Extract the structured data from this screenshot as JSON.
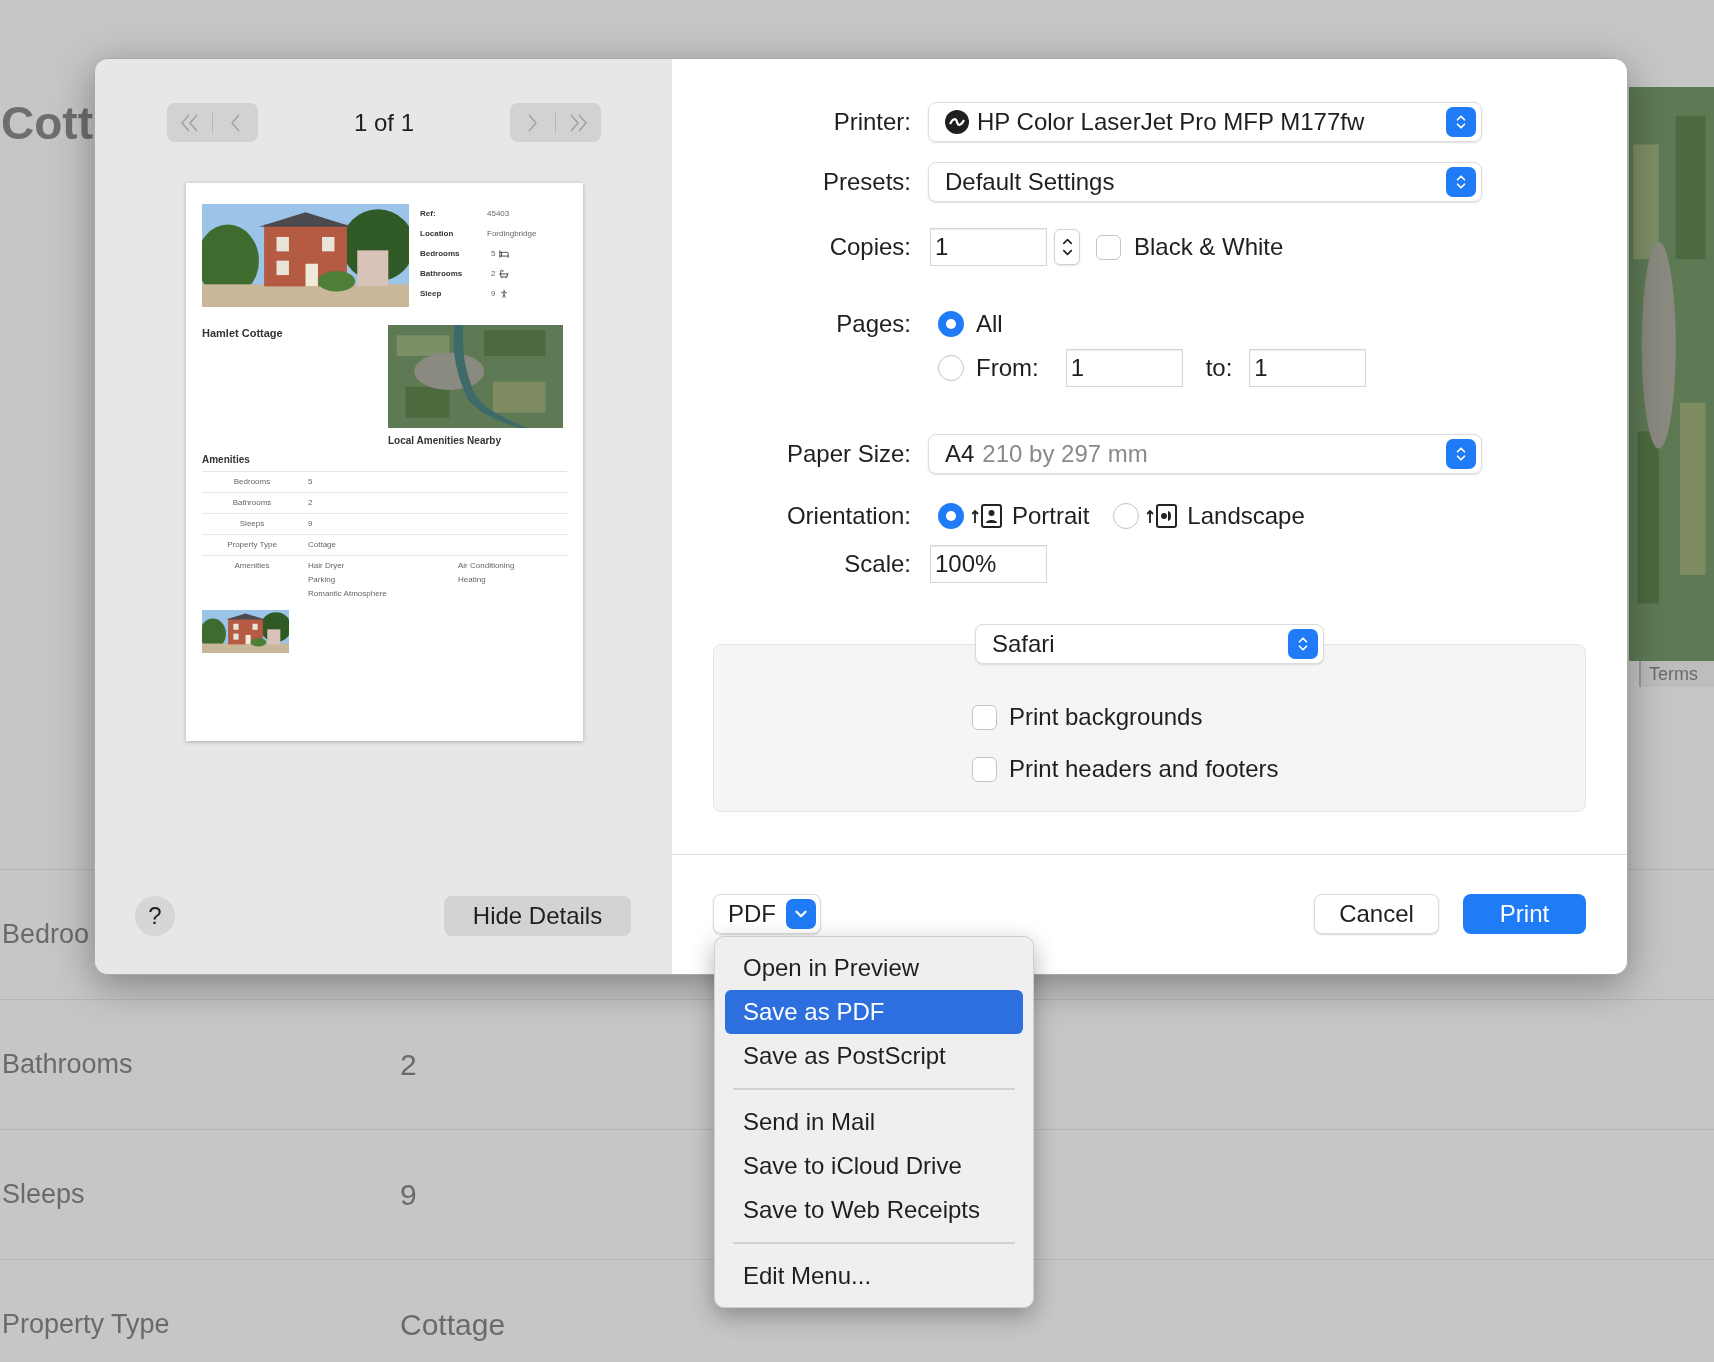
{
  "background": {
    "heading": "Cott",
    "terms": "Terms",
    "rows": [
      {
        "label": "Bedroo",
        "value": ""
      },
      {
        "label": "Bathrooms",
        "value": "2"
      },
      {
        "label": "Sleeps",
        "value": "9"
      },
      {
        "label": "Property Type",
        "value": "Cottage"
      }
    ]
  },
  "preview": {
    "page_indicator": "1 of 1",
    "nav_buttons": [
      {
        "kind": "first",
        "disabled": true
      },
      {
        "kind": "previous",
        "disabled": true
      },
      {
        "kind": "next",
        "disabled": true
      },
      {
        "kind": "last",
        "disabled": true
      }
    ],
    "page": {
      "facts": [
        {
          "label": "Ref:",
          "value": "45403"
        },
        {
          "label": "Location",
          "value": "Fordingbridge"
        },
        {
          "label": "Bedrooms",
          "value": "5"
        },
        {
          "label": "Bathrooms",
          "value": "2"
        },
        {
          "label": "Sleep",
          "value": "9"
        }
      ],
      "title": "Hamlet Cottage",
      "map_caption": "Local Amenities Nearby",
      "amenities_heading": "Amenities",
      "table": [
        {
          "label": "Bedrooms",
          "values": [
            "5"
          ]
        },
        {
          "label": "Bathrooms",
          "values": [
            "2"
          ]
        },
        {
          "label": "Sleeps",
          "values": [
            "9"
          ]
        },
        {
          "label": "Property Type",
          "values": [
            "Cottage"
          ]
        },
        {
          "label": "Amenities",
          "values": [
            "Hair Dryer",
            "Air Conditioning",
            "Parking",
            "Heating",
            "Romantic Atmosphere"
          ]
        }
      ]
    },
    "help_button": "?",
    "hide_details_button": "Hide Details"
  },
  "settings": {
    "printer": {
      "label": "Printer:",
      "value": "HP Color LaserJet Pro MFP M177fw"
    },
    "presets": {
      "label": "Presets:",
      "value": "Default Settings"
    },
    "copies": {
      "label": "Copies:",
      "value": "1",
      "black_white": {
        "label": "Black & White",
        "checked": false
      }
    },
    "pages": {
      "label": "Pages:",
      "all": {
        "label": "All",
        "selected": true
      },
      "range": {
        "label": "From:",
        "selected": false,
        "from": "1",
        "to_label": "to:",
        "to": "1"
      }
    },
    "paper_size": {
      "label": "Paper Size:",
      "value": "A4",
      "detail": "210 by 297 mm"
    },
    "orientation": {
      "label": "Orientation:",
      "options": [
        {
          "kind": "portrait",
          "label": "Portrait",
          "selected": true
        },
        {
          "kind": "landscape",
          "label": "Landscape",
          "selected": false
        }
      ]
    },
    "scale": {
      "label": "Scale:",
      "value": "100%"
    },
    "app_section": {
      "popup": "Safari",
      "options": [
        {
          "label": "Print backgrounds",
          "checked": false
        },
        {
          "label": "Print headers and footers",
          "checked": false
        }
      ]
    }
  },
  "footer": {
    "pdf_button": "PDF",
    "cancel_button": "Cancel",
    "print_button": "Print"
  },
  "pdf_menu": {
    "groups": [
      [
        {
          "label": "Open in Preview",
          "selected": false
        },
        {
          "label": "Save as PDF",
          "selected": true
        },
        {
          "label": "Save as PostScript",
          "selected": false
        }
      ],
      [
        {
          "label": "Send in Mail",
          "selected": false
        },
        {
          "label": "Save to iCloud Drive",
          "selected": false
        },
        {
          "label": "Save to Web Receipts",
          "selected": false
        }
      ],
      [
        {
          "label": "Edit Menu...",
          "selected": false
        }
      ]
    ]
  }
}
